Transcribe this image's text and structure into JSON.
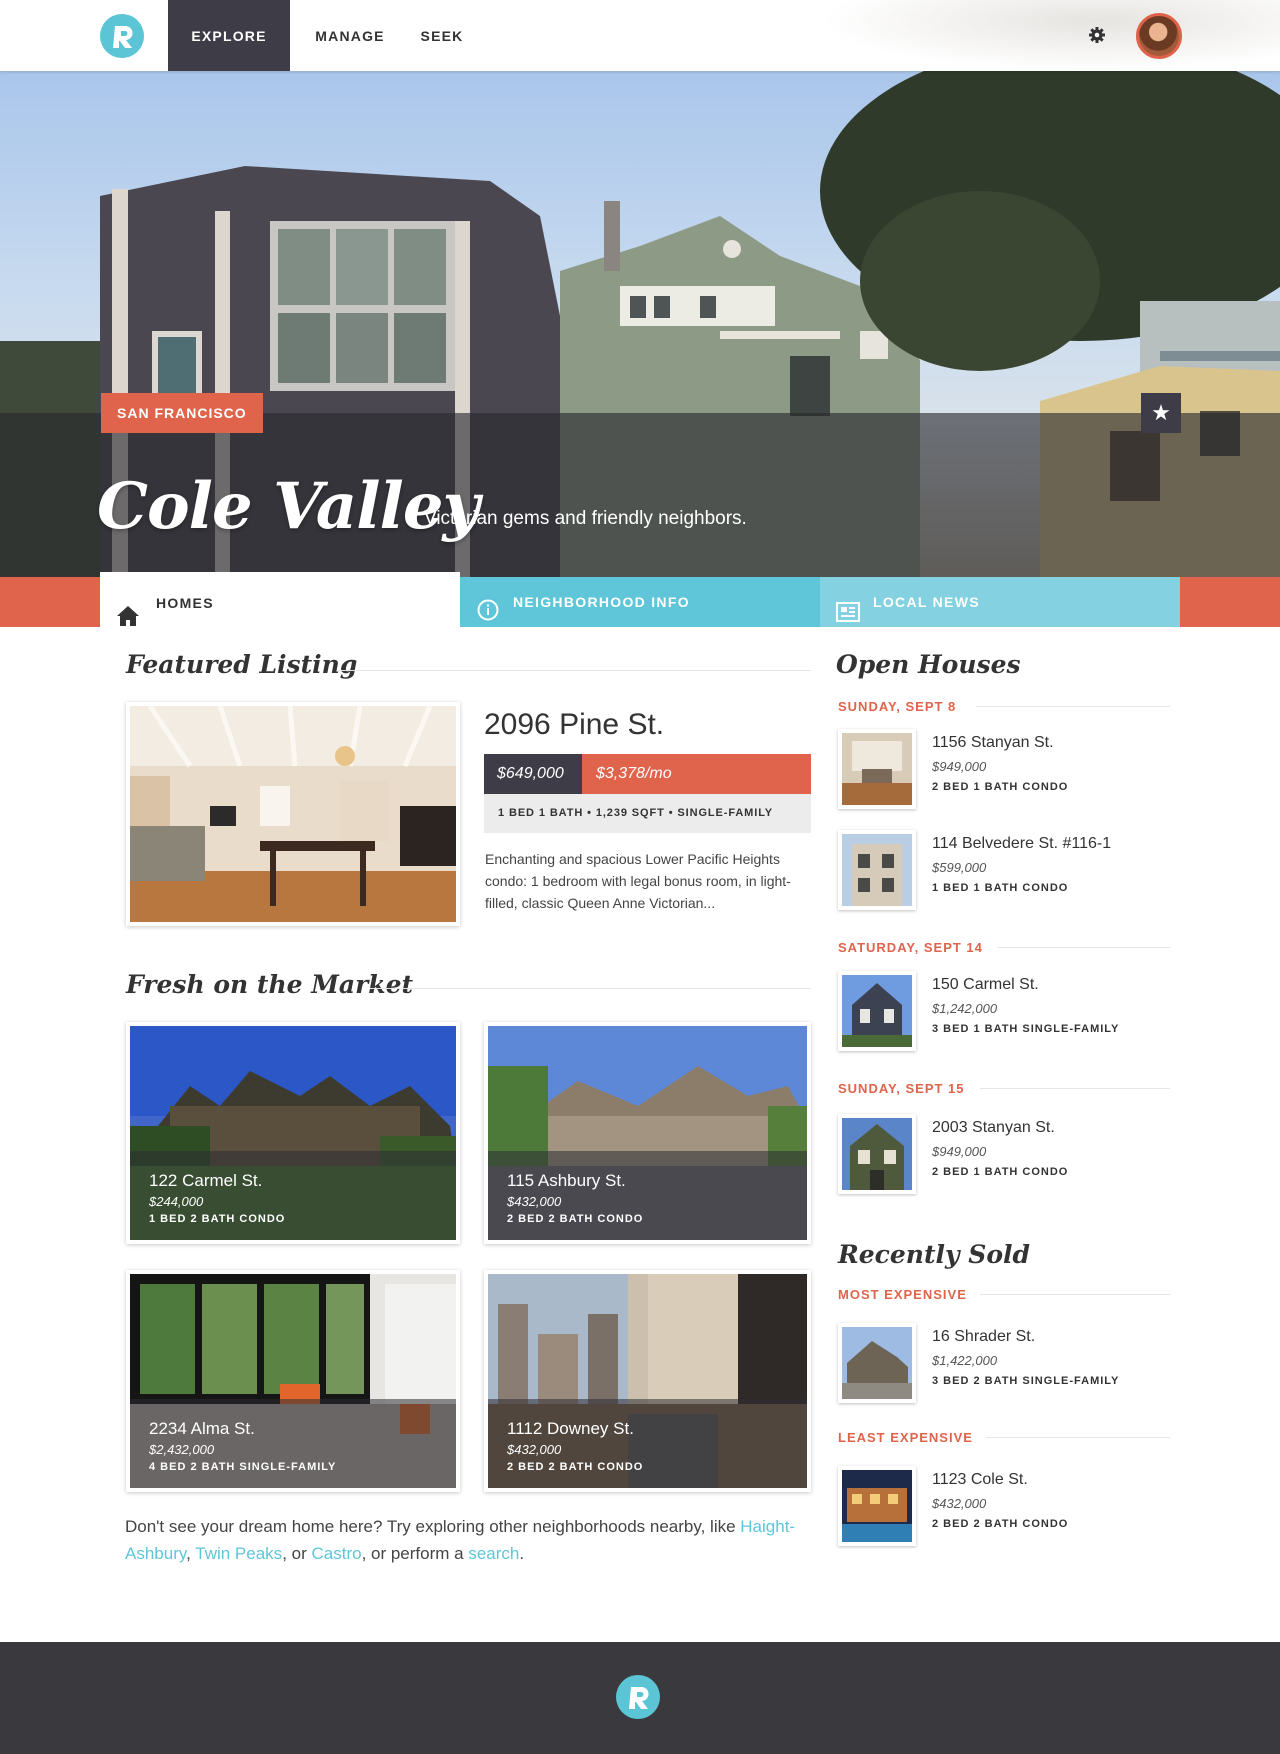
{
  "nav": {
    "logo": "R",
    "tabs": [
      "EXPLORE",
      "MANAGE",
      "SEEK"
    ],
    "active_tab": "EXPLORE"
  },
  "hero": {
    "city": "SAN FRANCISCO",
    "title": "Cole Valley",
    "tagline": "Victorian gems and friendly neighbors."
  },
  "section_tabs": [
    "HOMES",
    "NEIGHBORHOOD INFO",
    "LOCAL NEWS"
  ],
  "featured": {
    "heading": "Featured Listing",
    "address": "2096 Pine St.",
    "price": "$649,000",
    "monthly": "$3,378/mo",
    "specs": "1 BED 1 BATH  •  1,239 SQFT  •  SINGLE-FAMILY",
    "description": "Enchanting and spacious Lower Pacific Heights condo: 1 bedroom with legal bonus room, in light-filled, classic Queen Anne Victorian..."
  },
  "fresh": {
    "heading": "Fresh on the Market",
    "listings": [
      {
        "address": "122 Carmel St.",
        "price": "$244,000",
        "specs": "1 BED 2 BATH CONDO"
      },
      {
        "address": "115 Ashbury St.",
        "price": "$432,000",
        "specs": "2 BED 2 BATH CONDO"
      },
      {
        "address": "2234 Alma St.",
        "price": "$2,432,000",
        "specs": "4 BED 2 BATH SINGLE-FAMILY"
      },
      {
        "address": "1112 Downey St.",
        "price": "$432,000",
        "specs": "2 BED 2 BATH CONDO"
      }
    ]
  },
  "explore": {
    "text_before": "Don't see your dream home here? Try exploring other neighborhoods nearby, like ",
    "link1": "Haight-Ashbury",
    "sep1": ", ",
    "link2": "Twin Peaks",
    "sep2": ", or ",
    "link3": "Castro",
    "sep3": ", or perform a ",
    "link4": "search",
    "end": "."
  },
  "open_houses": {
    "heading": "Open Houses",
    "groups": [
      {
        "date": "SUNDAY, SEPT 8",
        "items": [
          {
            "address": "1156 Stanyan St.",
            "price": "$949,000",
            "specs": "2 BED 1 BATH CONDO"
          },
          {
            "address": "114 Belvedere St. #116-1",
            "price": "$599,000",
            "specs": "1 BED 1 BATH CONDO"
          }
        ]
      },
      {
        "date": "SATURDAY, SEPT 14",
        "items": [
          {
            "address": "150 Carmel St.",
            "price": "$1,242,000",
            "specs": "3 BED 1 BATH SINGLE-FAMILY"
          }
        ]
      },
      {
        "date": "SUNDAY, SEPT 15",
        "items": [
          {
            "address": "2003 Stanyan St.",
            "price": "$949,000",
            "specs": "2 BED 1 BATH CONDO"
          }
        ]
      }
    ]
  },
  "recently_sold": {
    "heading": "Recently Sold",
    "groups": [
      {
        "label": "MOST EXPENSIVE",
        "items": [
          {
            "address": "16 Shrader St.",
            "price": "$1,422,000",
            "specs": "3 BED 2 BATH SINGLE-FAMILY"
          }
        ]
      },
      {
        "label": "LEAST EXPENSIVE",
        "items": [
          {
            "address": "1123 Cole St.",
            "price": "$432,000",
            "specs": "2 BED 2 BATH CONDO"
          }
        ]
      }
    ]
  },
  "colors": {
    "accent": "#df644b",
    "teal": "#5ec6d8",
    "light_teal": "#84d1e1",
    "dark": "#3d3c47",
    "footer": "#3a393e"
  },
  "icons": [
    "logo-icon",
    "gear-icon",
    "star-icon",
    "home-icon",
    "info-icon",
    "newspaper-icon"
  ]
}
